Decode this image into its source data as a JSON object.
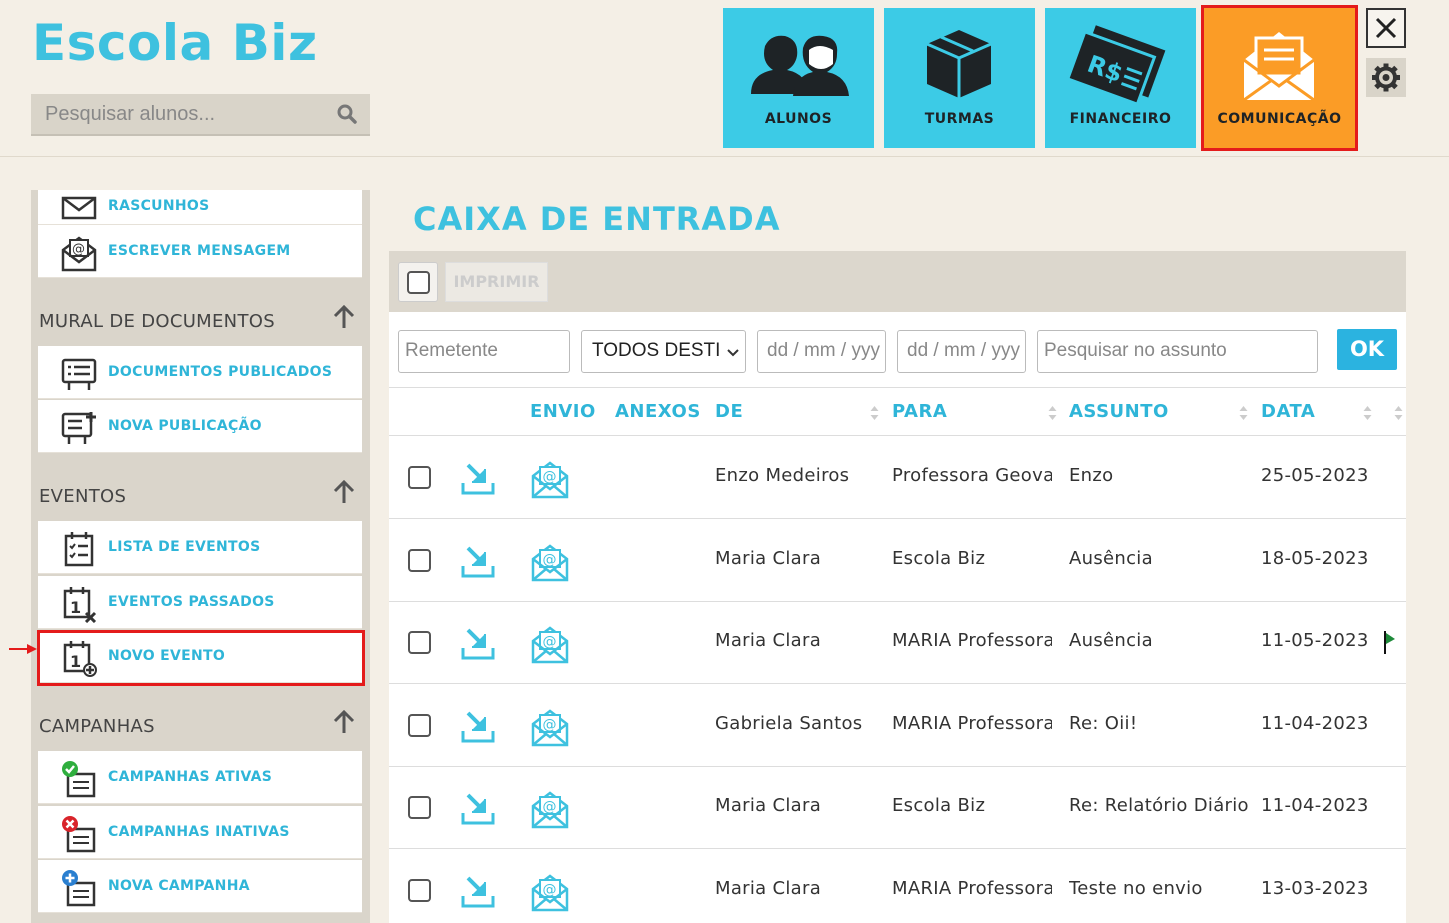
{
  "header": {
    "logo": "Escola Biz",
    "search_placeholder": "Pesquisar alunos...",
    "tiles": [
      {
        "label": "ALUNOS"
      },
      {
        "label": "TURMAS"
      },
      {
        "label": "FINANCEIRO"
      },
      {
        "label": "COMUNICAÇÃO",
        "active": true
      }
    ]
  },
  "sidebar": {
    "top_items": [
      {
        "label": "RASCUNHOS"
      },
      {
        "label": "ESCREVER MENSAGEM"
      }
    ],
    "sections": [
      {
        "title": "MURAL DE DOCUMENTOS",
        "items": [
          {
            "label": "DOCUMENTOS PUBLICADOS"
          },
          {
            "label": "NOVA PUBLICAÇÃO"
          }
        ]
      },
      {
        "title": "EVENTOS",
        "items": [
          {
            "label": "LISTA DE EVENTOS"
          },
          {
            "label": "EVENTOS PASSADOS"
          },
          {
            "label": "NOVO EVENTO",
            "highlighted": true
          }
        ]
      },
      {
        "title": "CAMPANHAS",
        "items": [
          {
            "label": "CAMPANHAS ATIVAS"
          },
          {
            "label": "CAMPANHAS INATIVAS"
          },
          {
            "label": "NOVA CAMPANHA"
          }
        ]
      }
    ]
  },
  "main": {
    "title": "CAIXA DE ENTRADA",
    "print_label": "IMPRIMIR",
    "filters": {
      "sender_placeholder": "Remetente",
      "recipient_select": "TODOS DESTI",
      "date_from_placeholder": "dd / mm / yyy",
      "date_to_placeholder": "dd / mm / yyy",
      "subject_placeholder": "Pesquisar no assunto",
      "ok_label": "OK"
    },
    "columns": [
      "ENVIO",
      "ANEXOS",
      "DE",
      "PARA",
      "ASSUNTO",
      "DATA"
    ],
    "rows": [
      {
        "de": "Enzo Medeiros",
        "para": "Professora Geovana",
        "assunto": "Enzo",
        "data": "25-05-2023",
        "flag": false
      },
      {
        "de": "Maria Clara",
        "para": "Escola Biz",
        "assunto": "Ausência",
        "data": "18-05-2023",
        "flag": false
      },
      {
        "de": "Maria Clara",
        "para": "MARIA Professora",
        "assunto": "Ausência",
        "data": "11-05-2023",
        "flag": true
      },
      {
        "de": "Gabriela Santos",
        "para": "MARIA Professora",
        "assunto": "Re: Oii!",
        "data": "11-04-2023",
        "flag": false
      },
      {
        "de": "Maria Clara",
        "para": "Escola Biz",
        "assunto": "Re: Relatório Diário",
        "data": "11-04-2023",
        "flag": false
      },
      {
        "de": "Maria Clara",
        "para": "MARIA Professora",
        "assunto": "Teste no envio",
        "data": "13-03-2023",
        "flag": false
      }
    ]
  },
  "colors": {
    "brand": "#3ec1df",
    "tile": "#3ccbe6",
    "tile_active": "#fb9c26",
    "highlight": "#e41b1b"
  }
}
